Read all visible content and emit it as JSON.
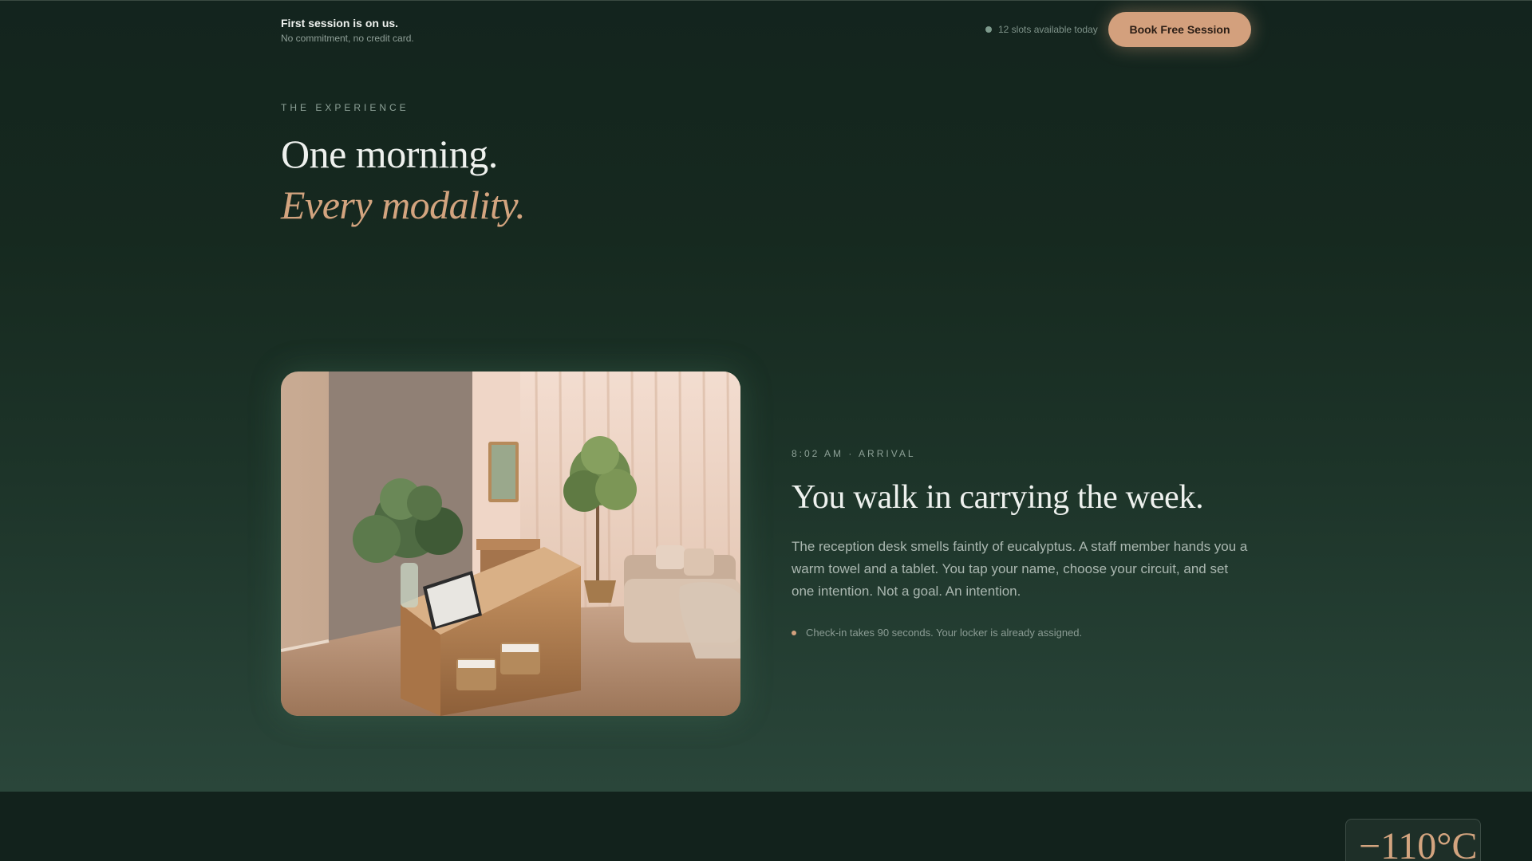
{
  "topbar": {
    "title": "First session is on us.",
    "subtitle": "No commitment, no credit card.",
    "slots_text": "12 slots available today",
    "cta_label": "Book Free Session"
  },
  "hero": {
    "eyebrow": "THE EXPERIENCE",
    "headline_line1": "One morning.",
    "headline_line2": "Every modality."
  },
  "arrival": {
    "time_label": "8:02 AM · ARRIVAL",
    "title": "You walk in carrying the week.",
    "body": "The reception desk smells faintly of eucalyptus. A staff member hands you a warm towel and a tablet. You tap your name, choose your circuit, and set one intention. Not a goal. An intention.",
    "note": "Check-in takes 90 seconds. Your locker is already assigned."
  },
  "badge": {
    "temperature": "−110°C"
  },
  "colors": {
    "accent": "#d3a07d",
    "background": "#14251f",
    "heading": "#eef1ee"
  },
  "icons": {
    "slot_indicator": "status-dot-icon",
    "note_bullet": "bullet-dot-icon"
  }
}
